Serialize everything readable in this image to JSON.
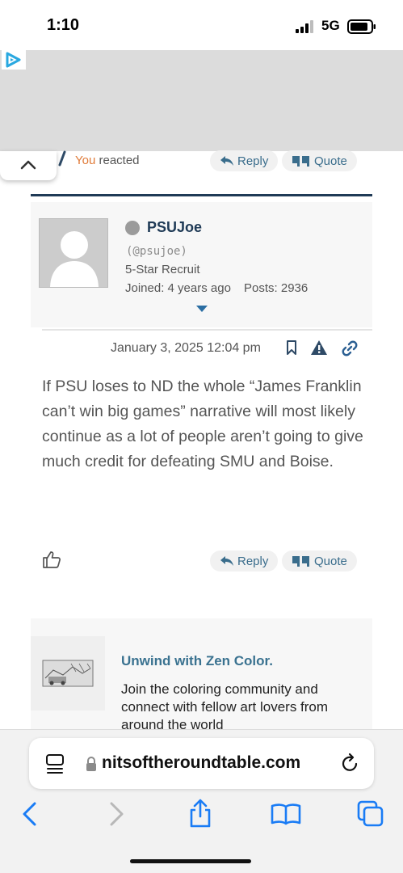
{
  "status_bar": {
    "time": "1:10",
    "network": "5G"
  },
  "prev_post": {
    "reacted_you": "You",
    "reacted_rest": " reacted",
    "reply_label": "Reply",
    "quote_label": "Quote"
  },
  "author": {
    "name": "PSUJoe",
    "handle": "(@psujoe)",
    "rank": "5-Star Recruit",
    "joined": "Joined: 4 years ago",
    "posts": "Posts: 2936"
  },
  "post": {
    "date": "January 3, 2025 12:04 pm",
    "body": "If PSU loses to ND the whole “James Franklin can’t win big games” narrative will most likely continue as a lot of people aren’t going to give much credit for defeating SMU and Boise.",
    "reply_label": "Reply",
    "quote_label": "Quote"
  },
  "promo": {
    "title": "Unwind with Zen Color.",
    "text": "Join the coloring community and connect with fellow art lovers from around the world"
  },
  "browser": {
    "url": "nitsoftheroundtable.com"
  },
  "colors": {
    "accent": "#3a6d8c",
    "divider": "#1f3a56",
    "ios_blue": "#1a7cf5",
    "reacted_orange": "#e07b39"
  }
}
